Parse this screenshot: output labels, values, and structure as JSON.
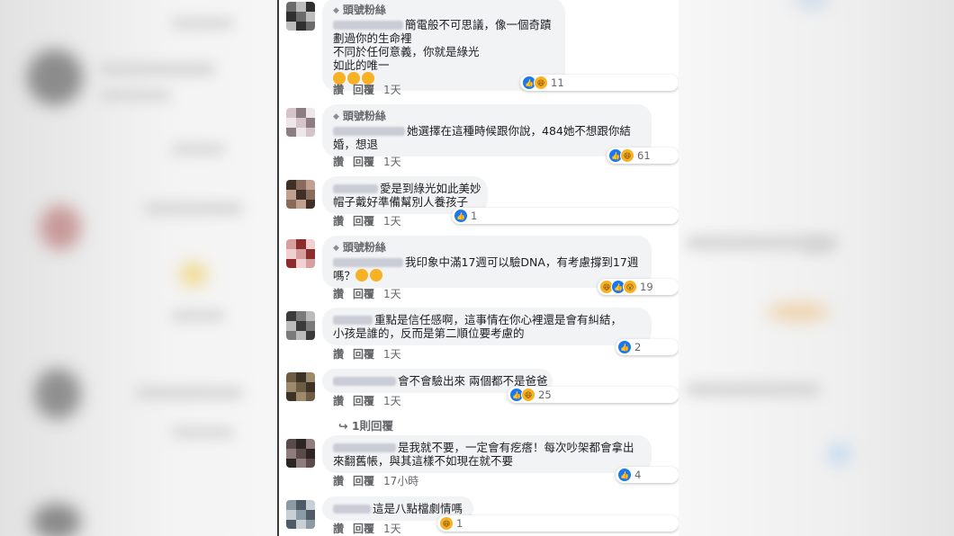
{
  "feed": {
    "badge_label": "頭號粉絲",
    "like_label": "讚",
    "reply_label": "回覆",
    "comments": [
      {
        "has_badge": true,
        "lines": [
          "簡電般不可思議，像一個奇蹟",
          "劃過你的生命裡",
          "不同於任何意義，你就是綠光",
          "如此的唯一"
        ],
        "reaction_count": "11",
        "time": "1天"
      },
      {
        "has_badge": true,
        "lines": [
          "她選擇在這種時候跟你說，484她不想跟你結",
          "婚，想退"
        ],
        "reaction_count": "61",
        "time": "1天"
      },
      {
        "has_badge": false,
        "lines": [
          "愛是到綠光如此美妙",
          "帽子戴好準備幫別人養孩子"
        ],
        "reaction_count": "1",
        "time": "1天"
      },
      {
        "has_badge": true,
        "lines": [
          "我印象中滿17週可以驗DNA，有考慮撐到17週",
          "嗎？"
        ],
        "reaction_count": "19",
        "time": "1天"
      },
      {
        "has_badge": false,
        "lines": [
          "重點是信任感啊，這事情在你心裡還是會有糾結，",
          "小孩是誰的，反而是第二順位要考慮的"
        ],
        "reaction_count": "2",
        "time": "1天"
      },
      {
        "has_badge": false,
        "lines": [
          "會不會驗出來 兩個都不是爸爸"
        ],
        "reaction_count": "25",
        "time": "1天",
        "replies": "1則回覆"
      },
      {
        "has_badge": false,
        "lines": [
          "是我就不要，一定會有疙瘩！每次吵架都會拿出",
          "來翻舊帳，與其這樣不如現在就不要"
        ],
        "reaction_count": "4",
        "time": "17小時"
      },
      {
        "has_badge": false,
        "lines": [
          "這是八點檔劇情嗎"
        ],
        "reaction_count": "1",
        "time": "1天"
      }
    ]
  },
  "colors": {
    "like_blue": "#1877f2",
    "bubble": "#f2f3f5",
    "meta_gray": "#65676b"
  }
}
